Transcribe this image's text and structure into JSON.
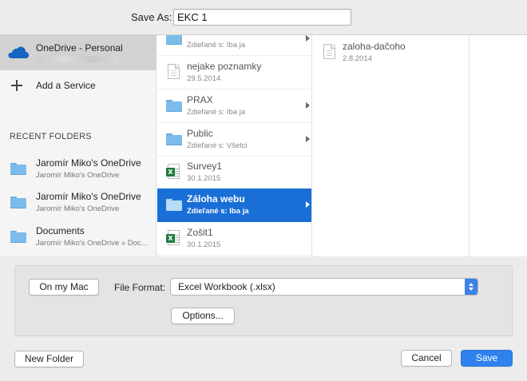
{
  "header": {
    "save_as_label": "Save As:",
    "file_name": "EKC 1"
  },
  "sidebar": {
    "account": {
      "label": "OneDrive - Personal",
      "icon": "cloud-icon"
    },
    "add_service": {
      "label": "Add a Service",
      "icon": "plus-icon"
    },
    "recent_title": "RECENT FOLDERS",
    "recent": [
      {
        "name": "Jaromír Miko's OneDrive",
        "sub": "Jaromír Miko's OneDrive"
      },
      {
        "name": "Jaromír Miko's OneDrive",
        "sub": "Jaromír Miko's OneDrive"
      },
      {
        "name": "Documents",
        "sub": "Jaromír Miko's OneDrive » Doc..."
      }
    ]
  },
  "column1": {
    "items": [
      {
        "name": "",
        "sub": "Zdieľané s: Iba ja",
        "type": "folder",
        "has_children": true
      },
      {
        "name": "nejake poznamky",
        "sub": "29.5.2014",
        "type": "doc",
        "has_children": false
      },
      {
        "name": "PRAX",
        "sub": "Zdieľané s: Iba ja",
        "type": "folder",
        "has_children": true
      },
      {
        "name": "Public",
        "sub": "Zdieľané s: Všetci",
        "type": "folder",
        "has_children": true
      },
      {
        "name": "Survey1",
        "sub": "30.1.2015",
        "type": "xls",
        "has_children": false
      },
      {
        "name": "Záloha webu",
        "sub": "Zdieľané s: Iba ja",
        "type": "folder",
        "has_children": true,
        "selected": true
      },
      {
        "name": "Zošit1",
        "sub": "30.1.2015",
        "type": "xls",
        "has_children": false
      }
    ]
  },
  "column2": {
    "items": [
      {
        "name": "zaloha-dačoho",
        "sub": "2.8.2014",
        "type": "doc"
      }
    ]
  },
  "options": {
    "on_my_mac": "On my Mac",
    "file_format_label": "File Format:",
    "file_format_value": "Excel Workbook (.xlsx)",
    "options_button": "Options..."
  },
  "footer": {
    "new_folder": "New Folder",
    "cancel": "Cancel",
    "save": "Save"
  },
  "colors": {
    "selection": "#1a6fd6",
    "save_button": "#2f82ee",
    "folder": "#7dbbeb",
    "excel": "#1f7a3e"
  }
}
